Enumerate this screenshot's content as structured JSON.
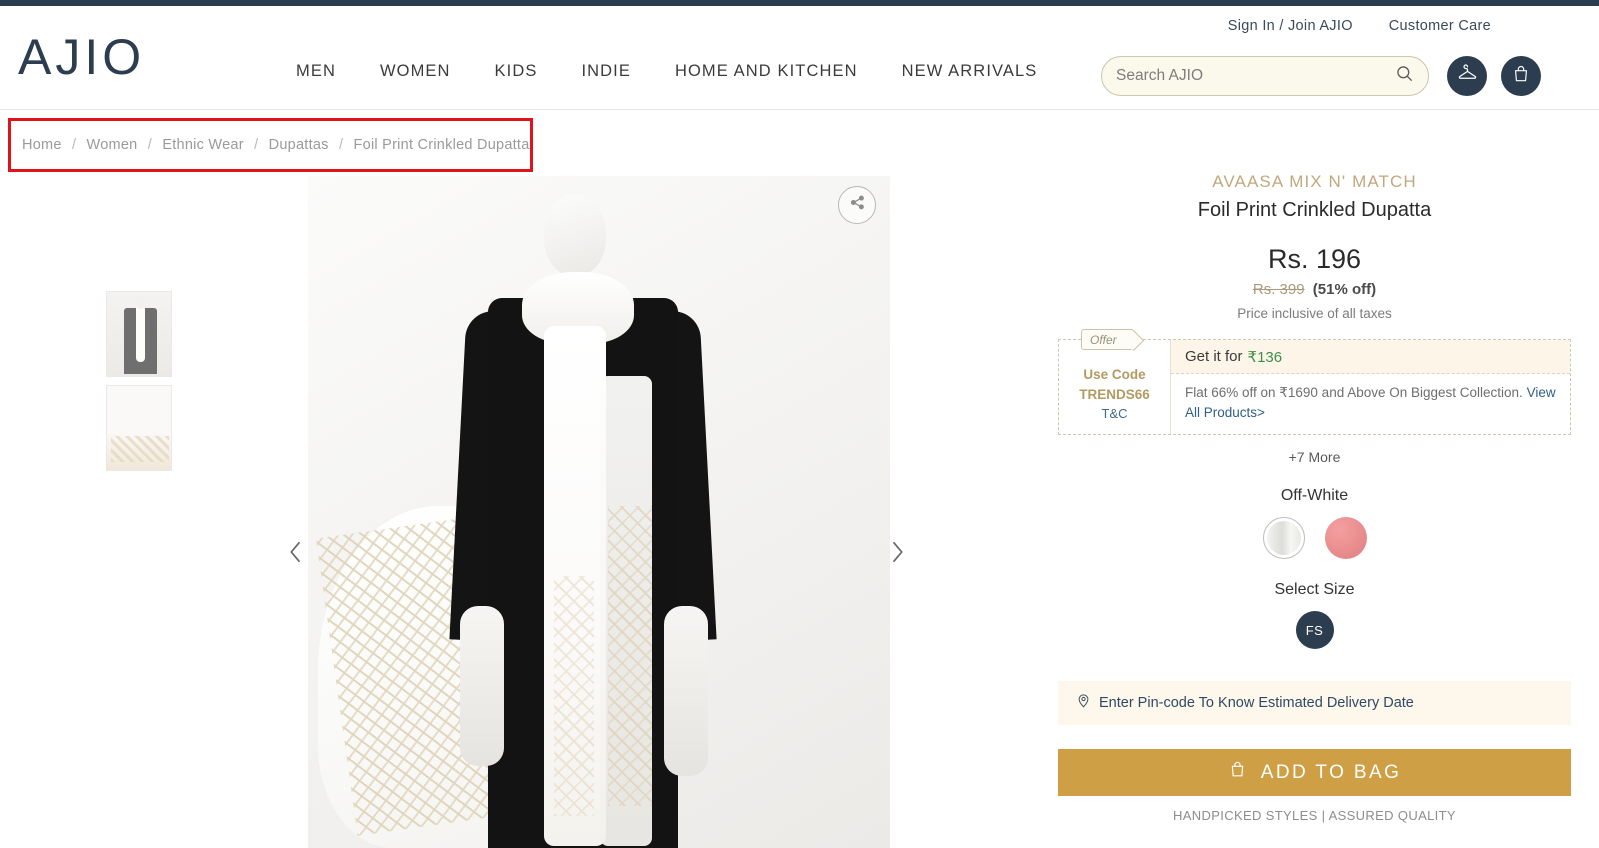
{
  "header": {
    "logo_text": "AJIO",
    "util_links": [
      {
        "label": "Sign In / Join AJIO"
      },
      {
        "label": "Customer Care"
      }
    ],
    "nav_items": [
      {
        "label": "MEN"
      },
      {
        "label": "WOMEN"
      },
      {
        "label": "KIDS"
      },
      {
        "label": "INDIE"
      },
      {
        "label": "HOME AND KITCHEN"
      },
      {
        "label": "NEW ARRIVALS"
      }
    ],
    "search": {
      "placeholder": "Search AJIO",
      "value": ""
    },
    "account_icon": "hanger-icon",
    "bag_icon": "shopping-bag-icon"
  },
  "breadcrumb": {
    "items": [
      {
        "label": "Home"
      },
      {
        "label": "Women"
      },
      {
        "label": "Ethnic Wear"
      },
      {
        "label": "Dupattas"
      },
      {
        "label": "Foil Print Crinkled Dupatta"
      }
    ],
    "separator": "/"
  },
  "gallery": {
    "share_icon": "share-icon",
    "prev_icon": "chevron-left-icon",
    "next_icon": "chevron-right-icon",
    "thumbnails": [
      {
        "alt": "Mannequin wearing black kurta with off-white dupatta"
      },
      {
        "alt": "Close-up of foil printed dupatta border"
      }
    ]
  },
  "product": {
    "brand": "AVAASA MIX N' MATCH",
    "name": "Foil Print Crinkled Dupatta",
    "price": "Rs. 196",
    "mrp": "Rs. 399",
    "discount": "(51% off)",
    "tax_note": "Price inclusive of all taxes",
    "offer": {
      "tag_label": "Offer",
      "use_code_line1": "Use Code",
      "use_code_line2": "TRENDS66",
      "tnc_label": "T&C",
      "get_it_prefix": "Get it for",
      "get_it_amount": "₹136",
      "description": "Flat 66% off on ₹1690 and Above On Biggest Collection.",
      "view_all_label": "View All Products>"
    },
    "more_offers": "+7 More",
    "color_label": "Off-White",
    "colors": [
      {
        "name": "Off-White",
        "hex": "#eeeeea",
        "selected": true
      },
      {
        "name": "Pink",
        "hex": "#e88486",
        "selected": false
      }
    ],
    "size_label": "Select Size",
    "sizes": [
      {
        "label": "FS",
        "selected": true
      }
    ],
    "pincode_label": "Enter Pin-code To Know Estimated Delivery Date",
    "pincode_icon": "location-pin-icon",
    "add_to_bag_label": "ADD TO BAG",
    "add_to_bag_icon": "shopping-bag-icon",
    "tagline": "HANDPICKED STYLES | ASSURED QUALITY"
  },
  "annotation": {
    "highlight_color": "#e0121a",
    "target": "breadcrumb"
  },
  "theme": {
    "navy": "#2b3d4f",
    "gold": "#cf9f45",
    "brand_beige": "#c1a87d",
    "green": "#3e8f4e",
    "search_bg": "#fbf8ec"
  }
}
